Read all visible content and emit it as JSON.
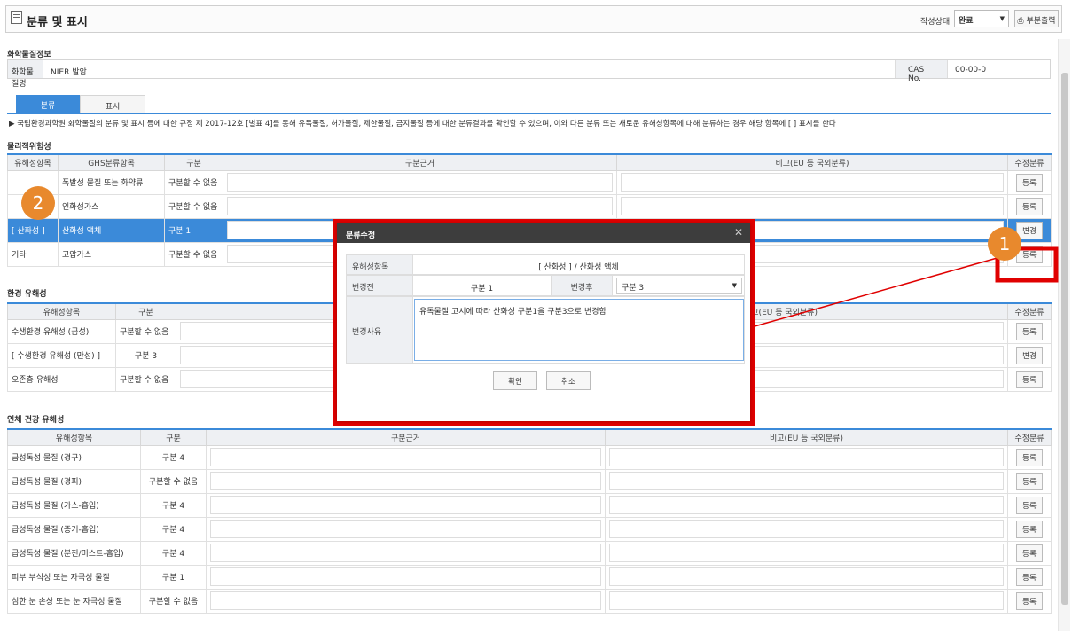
{
  "header": {
    "title": "분류 및 표시",
    "status_label": "작성상태",
    "status_value": "완료",
    "print_label": "부분출력"
  },
  "chemical": {
    "section_title": "화학물질정보",
    "name_label": "화학물질명",
    "name_value": "NIER 발암",
    "cas_label": "CAS No.",
    "cas_value": "00-00-0"
  },
  "tabs": [
    "분류",
    "표시"
  ],
  "notice": "▶ 국립환경과학원 화학물질의 분류 및 표시 등에 대한 규정 제 2017-12호 [별표 4]를 통해 유독물질, 허가물질, 제한물질, 금지물질 등에 대한 분류결과를 확인할 수 있으며, 이와 다른 분류 또는 새로운 유해성항목에 대해 분류하는 경우 해당 항목에 [ ] 표시를 한다",
  "physical": {
    "title": "물리적위험성",
    "headers": [
      "유해성항목",
      "GHS분류항목",
      "구분",
      "구분근거",
      "비고(EU 등 국외분류)",
      "수정분류"
    ],
    "rows": [
      {
        "item": "",
        "ghs": "폭발성 물질 또는 화약류",
        "cat": "구분할 수 없음",
        "btn": "등록"
      },
      {
        "item": "",
        "ghs": "인화성가스",
        "cat": "구분할 수 없음",
        "btn": "등록"
      },
      {
        "item": "[ 산화성 ]",
        "ghs": "산화성 액체",
        "cat": "구분 1",
        "btn": "변경"
      },
      {
        "item": "기타",
        "ghs": "고압가스",
        "cat": "구분할 수 없음",
        "btn": "등록"
      }
    ]
  },
  "environment": {
    "title": "환경 유해성",
    "headers": [
      "유해성항목",
      "구분",
      "비고(EU 등 국외분류)",
      "수정분류"
    ],
    "rows": [
      {
        "item": "수생환경 유해성 (급성)",
        "cat": "구분할 수 없음",
        "btn": "등록"
      },
      {
        "item": "[ 수생환경 유해성 (만성) ]",
        "cat": "구분 3",
        "btn": "변경"
      },
      {
        "item": "오존층 유해성",
        "cat": "구분할 수 없음",
        "btn": "등록"
      }
    ]
  },
  "health": {
    "title": "인체 건강 유해성",
    "headers": [
      "유해성항목",
      "구분",
      "구분근거",
      "비고(EU 등 국외분류)",
      "수정분류"
    ],
    "rows": [
      {
        "item": "급성독성 물질 (경구)",
        "cat": "구분 4",
        "btn": "등록"
      },
      {
        "item": "급성독성 물질 (경피)",
        "cat": "구분할 수 없음",
        "btn": "등록"
      },
      {
        "item": "급성독성 물질 (가스-흡입)",
        "cat": "구분 4",
        "btn": "등록"
      },
      {
        "item": "급성독성 물질 (증기-흡입)",
        "cat": "구분 4",
        "btn": "등록"
      },
      {
        "item": "급성독성 물질 (분진/미스트-흡입)",
        "cat": "구분 4",
        "btn": "등록"
      },
      {
        "item": "피부 부식성 또는 자극성 물질",
        "cat": "구분 1",
        "btn": "등록"
      },
      {
        "item": "심한 눈 손상 또는 눈 자극성 물질",
        "cat": "구분할 수 없음",
        "btn": "등록"
      }
    ]
  },
  "modal": {
    "title": "분류수정",
    "item_label": "유해성항목",
    "item_value": "[ 산화성 ] / 산화성 액체",
    "before_label": "변경전",
    "before_value": "구분 1",
    "after_label": "변경후",
    "after_value": "구분 3",
    "reason_label": "변경사유",
    "reason_value": "유독물질 고시에 따라 산화성 구분1을 구분3으로 변경함",
    "confirm": "확인",
    "cancel": "취소"
  },
  "callouts": [
    "1",
    "2"
  ],
  "colors": {
    "accent": "#3b8ad9",
    "highlight": "#e00000",
    "callout": "#e8892d",
    "modal_header": "#3d3d3d"
  }
}
